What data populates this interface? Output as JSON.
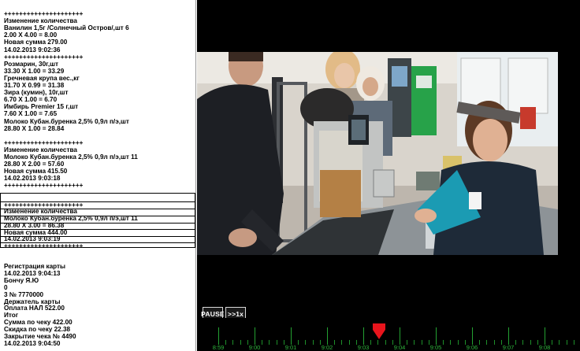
{
  "log": {
    "lines": [
      "+++++++++++++++++++++",
      "Изменение количества",
      "Ванилин 1,5г /Солнечный Остров/,шт 6",
      "2.00 X 4.00 = 8.00",
      "Новая сумма 279.00",
      "14.02.2013 9:02:36",
      "+++++++++++++++++++++",
      "Розмарин, 30г,шт",
      "33.30 X 1.00 = 33.29",
      "Гречневая крупа вес.,кг",
      "31.70 X 0.99 = 31.38",
      "Зира (кумин), 10г,шт",
      "6.70 X 1.00 = 6.70",
      "Имбирь Premier 15 г,шт",
      "7.60 X 1.00 = 7.65",
      "Молоко Кубан.буренка 2,5% 0,9л п/э,шт",
      "28.80 X 1.00 = 28.84",
      "",
      "+++++++++++++++++++++",
      "Изменение количества",
      "Молоко Кубан.буренка 2,5% 0,9л п/э,шт 11",
      "28.80 X 2.00 = 57.60",
      "Новая сумма 415.50",
      "14.02.2013 9:03:18",
      "+++++++++++++++++++++"
    ],
    "highlight_lines": [
      "",
      "+++++++++++++++++++++",
      "Изменение количества",
      "Молоко Кубан.буренка 2,5% 0,9л п/э,шт 11",
      "28.80 X 3.00 = 86.38",
      "Новая сумма 444.00",
      "14.02.2013 9:03:19",
      "+++++++++++++++++++++"
    ],
    "lines_after": [
      "Регистрация карты",
      "14.02.2013 9:04:13",
      "Бончу Я.Ю",
      "0",
      "3 № 7770000",
      "Держатель карты",
      "Оплата НАЛ 522.00",
      "Итог",
      "Сумма по чеку 422.00",
      "Скидка по чеку 22.38",
      "Закрытие чека № 4490",
      "14.02.2013 9:04:50"
    ]
  },
  "controls": {
    "pause_label": "PAUSE",
    "speed_label": ">>1x"
  },
  "timeline": {
    "labels": [
      "8:59",
      "9:00",
      "9:01",
      "9:02",
      "9:03",
      "9:04",
      "9:05",
      "9:06",
      "9:07",
      "9:08"
    ],
    "marker_color": "#e8141c",
    "tick_color": "#24a132"
  },
  "colors": {
    "video_background": "#000000",
    "log_text": "#000000",
    "log_background": "#ffffff"
  }
}
